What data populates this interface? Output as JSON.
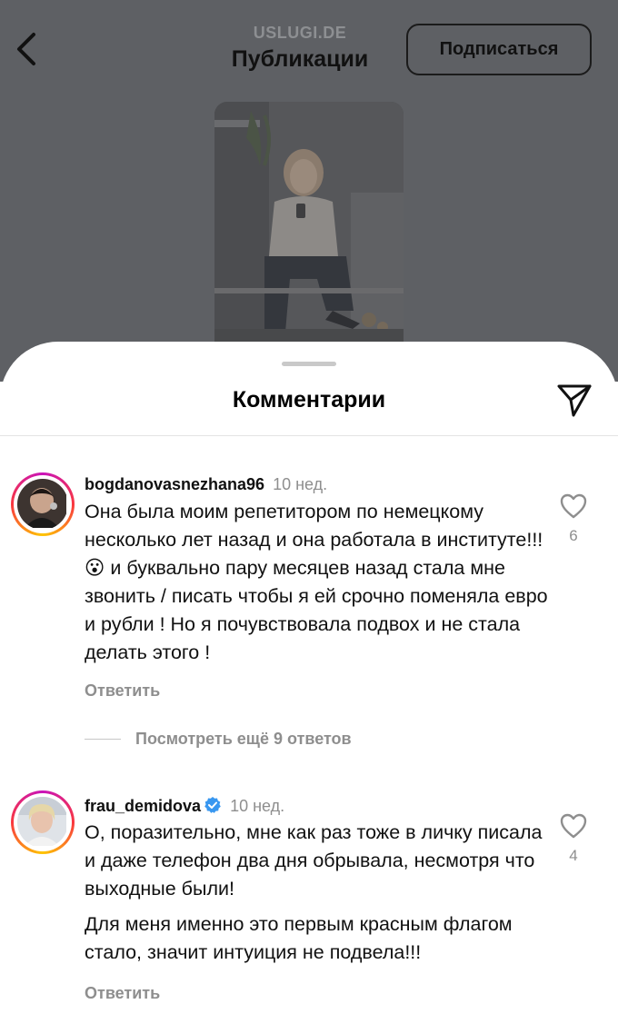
{
  "header": {
    "account": "USLUGI.DE",
    "title": "Публикации",
    "subscribe_label": "Подписаться"
  },
  "sheet": {
    "title": "Комментарии"
  },
  "comments": [
    {
      "username": "bogdanovasnezhana96",
      "time": "10 нед.",
      "lines": [
        "Она была моим репетитором по немецкому несколько лет назад и она работала в институте!!!😮 и буквально пару месяцев назад  стала мне звонить / писать чтобы я ей срочно поменяла евро и рубли ! Но я почувствовала подвох и не стала делать этого !"
      ],
      "likes": "6",
      "reply_label": "Ответить",
      "more_replies": "Посмотреть ещё 9 ответов"
    },
    {
      "username": "frau_demidova",
      "verified": true,
      "time": "10 нед.",
      "lines": [
        "О, поразительно, мне как раз тоже в личку писала и даже телефон два дня обрывала, несмотря что выходные были!",
        "Для меня именно это первым красным флагом стало, значит интуиция не подвела!!!"
      ],
      "likes": "4",
      "reply_label": "Ответить"
    }
  ],
  "icons": {
    "back": "chevron-left-icon",
    "share": "paper-plane-icon",
    "like": "heart-outline-icon",
    "verified": "verified-badge-icon"
  },
  "colors": {
    "backdrop": "#5e6064",
    "verified": "#3897f0",
    "muted": "#8e8e8e"
  }
}
